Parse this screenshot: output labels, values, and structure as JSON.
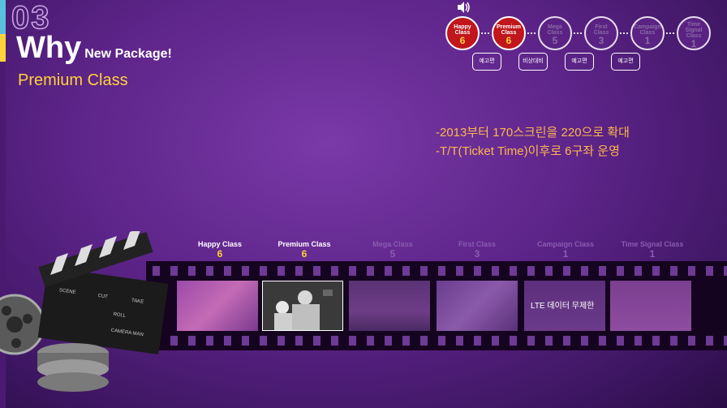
{
  "slide": {
    "number": "03",
    "title_big": "Why",
    "title_small": "New Package!",
    "subtitle": "Premium Class",
    "notes": [
      "-2013부터 170스크린을 220으로 확대",
      "-T/T(Ticket Time)이후로 6구좌 운영"
    ]
  },
  "circles": [
    {
      "name": "Happy\nClass",
      "value": "6",
      "active": true
    },
    {
      "name": "Premium\nClass",
      "value": "6",
      "active": true
    },
    {
      "name": "Mega\nClass",
      "value": "5",
      "active": false
    },
    {
      "name": "First\nClass",
      "value": "3",
      "active": false
    },
    {
      "name": "Campaign\nClass",
      "value": "1",
      "active": false
    },
    {
      "name": "Time\nSignal\nClass",
      "value": "1",
      "active": false
    }
  ],
  "bubbles": [
    "예고편",
    "비상대비",
    "예고편",
    "예고편"
  ],
  "film_labels": [
    {
      "name": "Happy Class",
      "value": "6",
      "dim": false
    },
    {
      "name": "Premium Class",
      "value": "6",
      "dim": false
    },
    {
      "name": "Mega Class",
      "value": "5",
      "dim": true
    },
    {
      "name": "First Class",
      "value": "3",
      "dim": true
    },
    {
      "name": "Campaign Class",
      "value": "1",
      "dim": true
    },
    {
      "name": "Time Signal Class",
      "value": "1",
      "dim": true
    }
  ],
  "frame_caption": "LTE 데이터 무제한",
  "clapper_labels": [
    "SCENE",
    "CUT",
    "TAKE",
    "ROLL",
    "CAMERA MAN"
  ],
  "colors": {
    "background": "#5d2489",
    "accent_yellow": "#ffd23a",
    "active_red": "#c0161c",
    "note_orange": "#ffb74d"
  }
}
